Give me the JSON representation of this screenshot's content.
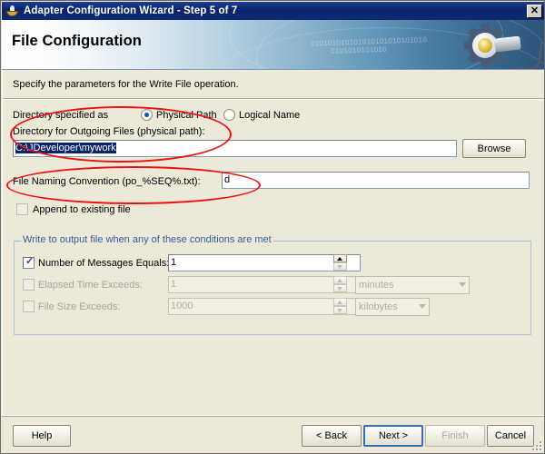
{
  "window": {
    "title": "Adapter Configuration Wizard - Step 5 of 7",
    "icon": "coffee-cup-icon",
    "close_label": "✕"
  },
  "banner": {
    "heading": "File Configuration",
    "binary_line1": "010101010101010101010101010",
    "binary_line2": "0101010101010",
    "graphic": "gear-and-plug-graphic"
  },
  "main": {
    "instruction": "Specify the parameters for the Write File operation.",
    "directory_specified_as_label": "Directory specified as",
    "radios": [
      {
        "label": "Physical Path",
        "mnemonic": "P",
        "selected": true
      },
      {
        "label": "Logical Name",
        "mnemonic": "L",
        "selected": false
      }
    ],
    "directory_label": "Directory for Outgoing Files (physical path):",
    "directory_mnemonic": "D",
    "directory_value": "C:\\JDeveloper\\mywork",
    "browse_label": "Browse",
    "browse_mnemonic": "r",
    "naming_label": "File Naming Convention (po_%SEQ%.txt):",
    "naming_mnemonic": "F",
    "naming_value": "d",
    "append_label": "Append to existing file",
    "append_mnemonic": "A",
    "append_checked": false
  },
  "conditions": {
    "group_title": "Write to output file when any of these conditions are met",
    "rows": [
      {
        "label": "Number of Messages Equals:",
        "mnemonic": "m",
        "checked": true,
        "enabled": true,
        "value": "1",
        "unit": null
      },
      {
        "label": "Elapsed Time Exceeds:",
        "mnemonic": "E",
        "checked": false,
        "enabled": false,
        "value": "1",
        "unit": "minutes"
      },
      {
        "label": "File Size Exceeds:",
        "mnemonic": "S",
        "checked": false,
        "enabled": false,
        "value": "1000",
        "unit": "kilobytes"
      }
    ]
  },
  "footer": {
    "help_label": "Help",
    "help_mnemonic": "H",
    "back_label": "< Back",
    "back_mnemonic": "B",
    "next_label": "Next >",
    "next_mnemonic": "N",
    "finish_label": "Finish",
    "finish_mnemonic": "F",
    "cancel_label": "Cancel"
  },
  "annotations": {
    "ellipse_1": "highlight-directory-field",
    "ellipse_2": "highlight-file-naming-field"
  },
  "colors": {
    "titlebar": "#10276e",
    "dialog_face": "#ece9d8",
    "group_title_text": "#31639c",
    "selection": "#0a246a",
    "annotation_red": "#ee1111",
    "focus_border": "#3c6fb2"
  }
}
